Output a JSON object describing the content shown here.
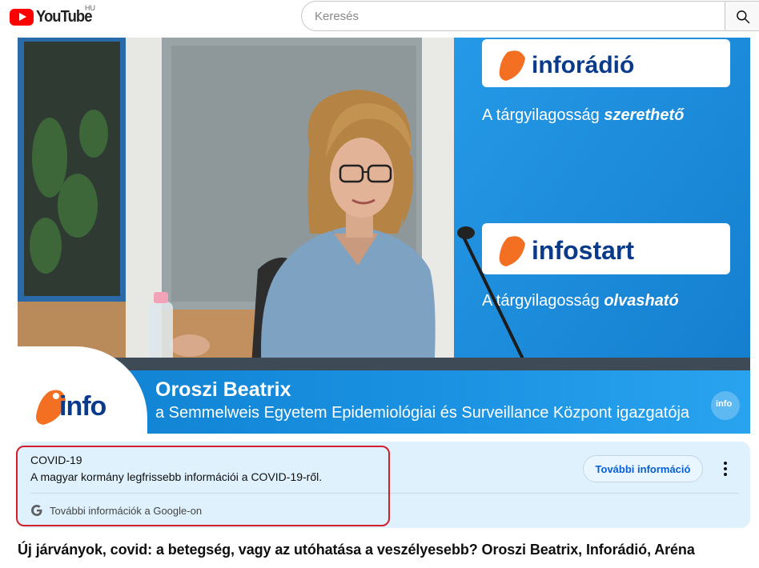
{
  "header": {
    "logo_text": "YouTube",
    "region": "HU",
    "search_placeholder": "Keresés"
  },
  "video": {
    "studio_banners": [
      {
        "brand": "inforádió",
        "tagline_prefix": "A tárgyilagosság ",
        "tagline_emphasis": "szerethető"
      },
      {
        "brand": "infostart",
        "tagline_prefix": "A tárgyilagosság ",
        "tagline_emphasis": "olvasható"
      }
    ],
    "lower_third": {
      "logo_text": "info",
      "name": "Oroszi Beatrix",
      "role": "a Semmelweis Egyetem Epidemiológiai és Surveillance Központ igazgatója",
      "bug_text": "info"
    }
  },
  "info_panel": {
    "topic": "COVID-19",
    "description": "A magyar kormány legfrissebb információi a COVID-19-ről.",
    "source": "További információk a Google-on",
    "more_button": "További információ"
  },
  "title": "Új járványok, covid: a betegség, vagy az utóhatása a veszélyesebb? Oroszi Beatrix, Inforádió, Aréna",
  "colors": {
    "youtube_red": "#ff0000",
    "panel_bg": "#def1fd",
    "link_blue": "#065fd4",
    "highlight_red": "#d31f2b",
    "studio_blue": "#1b93e2",
    "brand_orange": "#f36f21"
  }
}
